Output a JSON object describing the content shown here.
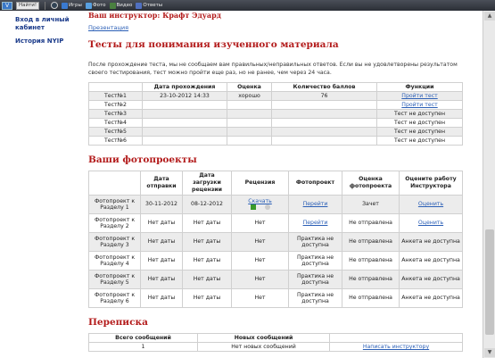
{
  "toolbar": {
    "logo": "V",
    "search_label": "Найти!",
    "items": [
      {
        "label": "Игры",
        "icon": "games-icon",
        "color": "#3a7ad0"
      },
      {
        "label": "Фото",
        "icon": "photo-icon",
        "color": "#58a0e0"
      },
      {
        "label": "Видео",
        "icon": "video-icon",
        "color": "#4a8040"
      },
      {
        "label": "Ответы",
        "icon": "answers-icon",
        "color": "#5070c0"
      }
    ]
  },
  "sidebar": {
    "items": [
      {
        "label": "Вход в личный кабинет"
      },
      {
        "label": "История NYIP"
      }
    ]
  },
  "header": {
    "instructor": "Ваш инструктор: Крафт Эдуард",
    "presentation": "Презентация"
  },
  "tests": {
    "title": "Тесты для понимания изученного материала",
    "intro": "После прохождение теста, мы не сообщаем вам правильных/неправильных ответов. Если вы не удовлетворены результатом своего тестирования, тест можно пройти еще раз, но не ранее, чем через 24 часа.",
    "columns": [
      "",
      "Дата прохождения",
      "Оценка",
      "Количество баллов",
      "Функции"
    ],
    "rows": [
      {
        "name": "Тест№1",
        "date": "23-10-2012 14:33",
        "grade": "хорошо",
        "score": "76",
        "action": "Пройти тест",
        "link": true
      },
      {
        "name": "Тест№2",
        "date": "",
        "grade": "",
        "score": "",
        "action": "Пройти тест",
        "link": true
      },
      {
        "name": "Тест№3",
        "date": "",
        "grade": "",
        "score": "",
        "action": "Тест не доступен",
        "link": false
      },
      {
        "name": "Тест№4",
        "date": "",
        "grade": "",
        "score": "",
        "action": "Тест не доступен",
        "link": false
      },
      {
        "name": "Тест№5",
        "date": "",
        "grade": "",
        "score": "",
        "action": "Тест не доступен",
        "link": false
      },
      {
        "name": "Тест№6",
        "date": "",
        "grade": "",
        "score": "",
        "action": "Тест не доступен",
        "link": false
      }
    ]
  },
  "photos": {
    "title": "Ваши фотопроекты",
    "columns": [
      "",
      "Дата отправки",
      "Дата загрузки рецензии",
      "Рецензия",
      "Фотопроект",
      "Оценка фотопроекта",
      "Оцените работу Инструктора"
    ],
    "rows": [
      {
        "name": "Фотопроект к Разделу 1",
        "sent": "30-11-2012",
        "review_date": "08-12-2012",
        "review": "Скачать",
        "project": "Перейти",
        "grade": "Зачет",
        "rate": "Оценить",
        "review_link": true,
        "project_link": true,
        "rate_link": true
      },
      {
        "name": "Фотопроект к Разделу 2",
        "sent": "Нет даты",
        "review_date": "Нет даты",
        "review": "Нет",
        "project": "Перейти",
        "grade": "Не отправлена",
        "rate": "Оценить",
        "review_link": false,
        "project_link": true,
        "rate_link": true
      },
      {
        "name": "Фотопроект к Разделу 3",
        "sent": "Нет даты",
        "review_date": "Нет даты",
        "review": "Нет",
        "project": "Практика не доступна",
        "grade": "Не отправлена",
        "rate": "Анкета не доступна",
        "review_link": false,
        "project_link": false,
        "rate_link": false
      },
      {
        "name": "Фотопроект к Разделу 4",
        "sent": "Нет даты",
        "review_date": "Нет даты",
        "review": "Нет",
        "project": "Практика не доступна",
        "grade": "Не отправлена",
        "rate": "Анкета не доступна",
        "review_link": false,
        "project_link": false,
        "rate_link": false
      },
      {
        "name": "Фотопроект к Разделу 5",
        "sent": "Нет даты",
        "review_date": "Нет даты",
        "review": "Нет",
        "project": "Практика не доступна",
        "grade": "Не отправлена",
        "rate": "Анкета не доступна",
        "review_link": false,
        "project_link": false,
        "rate_link": false
      },
      {
        "name": "Фотопроект к Разделу 6",
        "sent": "Нет даты",
        "review_date": "Нет даты",
        "review": "Нет",
        "project": "Практика не доступна",
        "grade": "Не отправлена",
        "rate": "Анкета не доступна",
        "review_link": false,
        "project_link": false,
        "rate_link": false
      }
    ]
  },
  "correspondence": {
    "title": "Переписка",
    "columns": [
      "Всего сообщений",
      "Новых сообщений",
      ""
    ],
    "row": {
      "total": "1",
      "new": "Нет новых сообщений",
      "action": "Написать инструктору"
    }
  },
  "colors": {
    "accent": "#b31b1b",
    "link": "#2b5fb6",
    "nav": "#1a3a8a"
  }
}
